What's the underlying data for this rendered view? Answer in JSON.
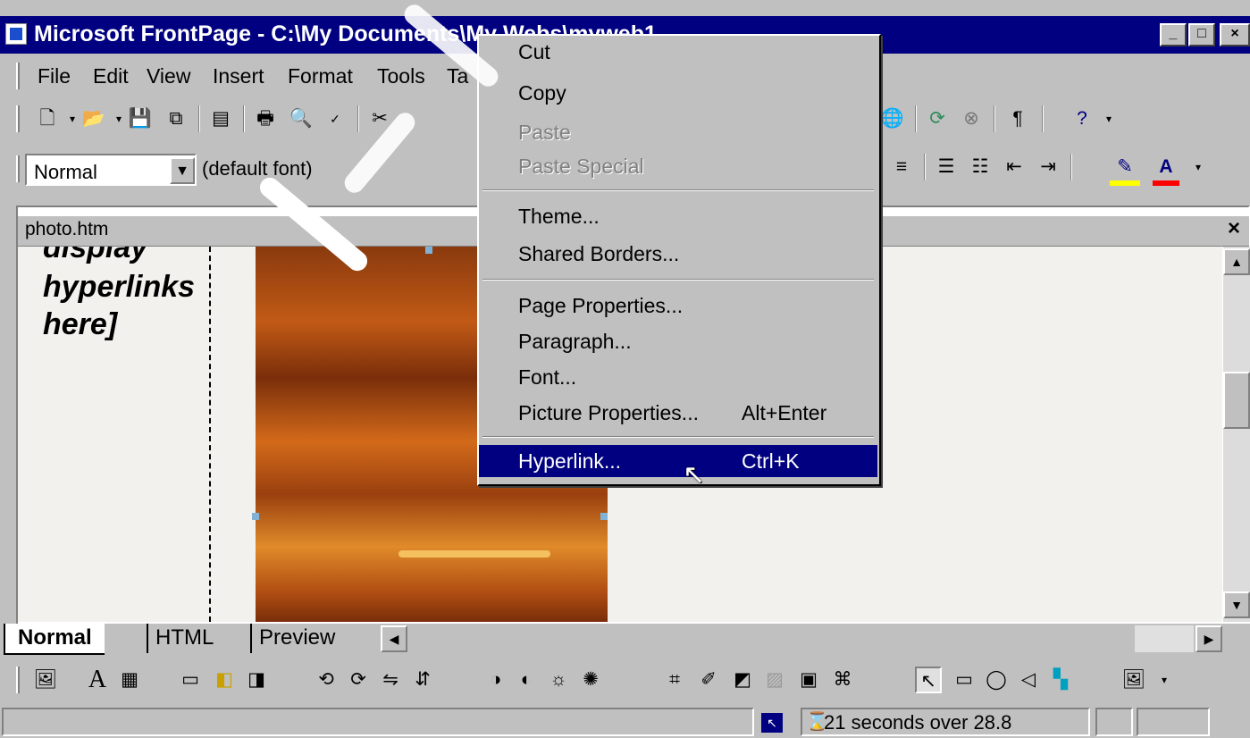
{
  "window": {
    "title": "Microsoft FrontPage - C:\\My Documents\\My Webs\\myweb1",
    "minimize": "_",
    "maximize": "□",
    "close": "×"
  },
  "menubar": {
    "items": [
      "File",
      "Edit",
      "View",
      "Insert",
      "Format",
      "Tools",
      "Ta"
    ]
  },
  "formatting": {
    "style_value": "Normal",
    "font_value": "(default font)",
    "colors": {
      "highlight": "#ffff00",
      "font_color": "#ff0000"
    }
  },
  "document": {
    "tab_title": "photo.htm",
    "close_glyph": "×",
    "nav_text": [
      "display",
      "hyperlinks",
      "here]"
    ]
  },
  "view_tabs": [
    "Normal",
    "HTML",
    "Preview"
  ],
  "status": {
    "download_time": "21 seconds over 28.8"
  },
  "context_menu": {
    "items": [
      {
        "label": "Cut",
        "enabled": true
      },
      {
        "label": "Copy",
        "enabled": true
      },
      {
        "label": "Paste",
        "enabled": false
      },
      {
        "label": "Paste Special",
        "enabled": false
      },
      {
        "label": "Theme...",
        "enabled": true
      },
      {
        "label": "Shared Borders...",
        "enabled": true
      },
      {
        "label": "Page Properties...",
        "enabled": true
      },
      {
        "label": "Paragraph...",
        "enabled": true
      },
      {
        "label": "Font...",
        "enabled": true
      },
      {
        "label": "Picture Properties...",
        "shortcut": "Alt+Enter",
        "enabled": true
      },
      {
        "label": "Hyperlink...",
        "shortcut": "Ctrl+K",
        "enabled": true,
        "highlighted": true
      }
    ]
  }
}
